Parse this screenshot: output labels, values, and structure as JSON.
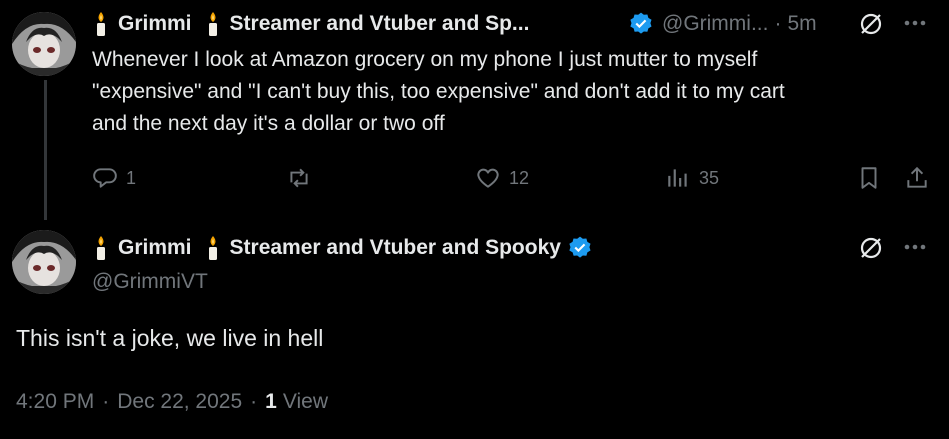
{
  "colors": {
    "background": "#000000",
    "text": "#e7e9ea",
    "muted": "#71767b",
    "verified": "#1d9bf0",
    "divider": "#333639"
  },
  "reply": {
    "display_name_first": "Grimmi",
    "display_name_second": "Streamer and Vtuber and Sp...",
    "handle": "@Grimmi...",
    "separator": "·",
    "time": "5m",
    "text_line1": "Whenever I look at Amazon grocery on my phone I just mutter to myself",
    "text_line2": "\"expensive\" and \"I can't buy this, too expensive\" and don't add it to my cart",
    "text_line3": "and the next day it's a dollar or two off",
    "actions": {
      "replies": "1",
      "reposts": "",
      "likes": "12",
      "views": "35"
    },
    "icons": [
      "candle-icon",
      "verified-badge-icon",
      "grok-icon",
      "more-icon",
      "reply-icon",
      "repost-icon",
      "like-icon",
      "views-icon",
      "bookmark-icon",
      "share-icon"
    ]
  },
  "main": {
    "display_name_first": "Grimmi",
    "display_name_second": "Streamer and Vtuber and Spooky",
    "handle": "@GrimmiVT",
    "text": "This isn't a joke, we live in hell",
    "time": "4:20 PM",
    "date": "Dec 22, 2025",
    "separator": "·",
    "views_count": "1",
    "views_label": "View"
  }
}
